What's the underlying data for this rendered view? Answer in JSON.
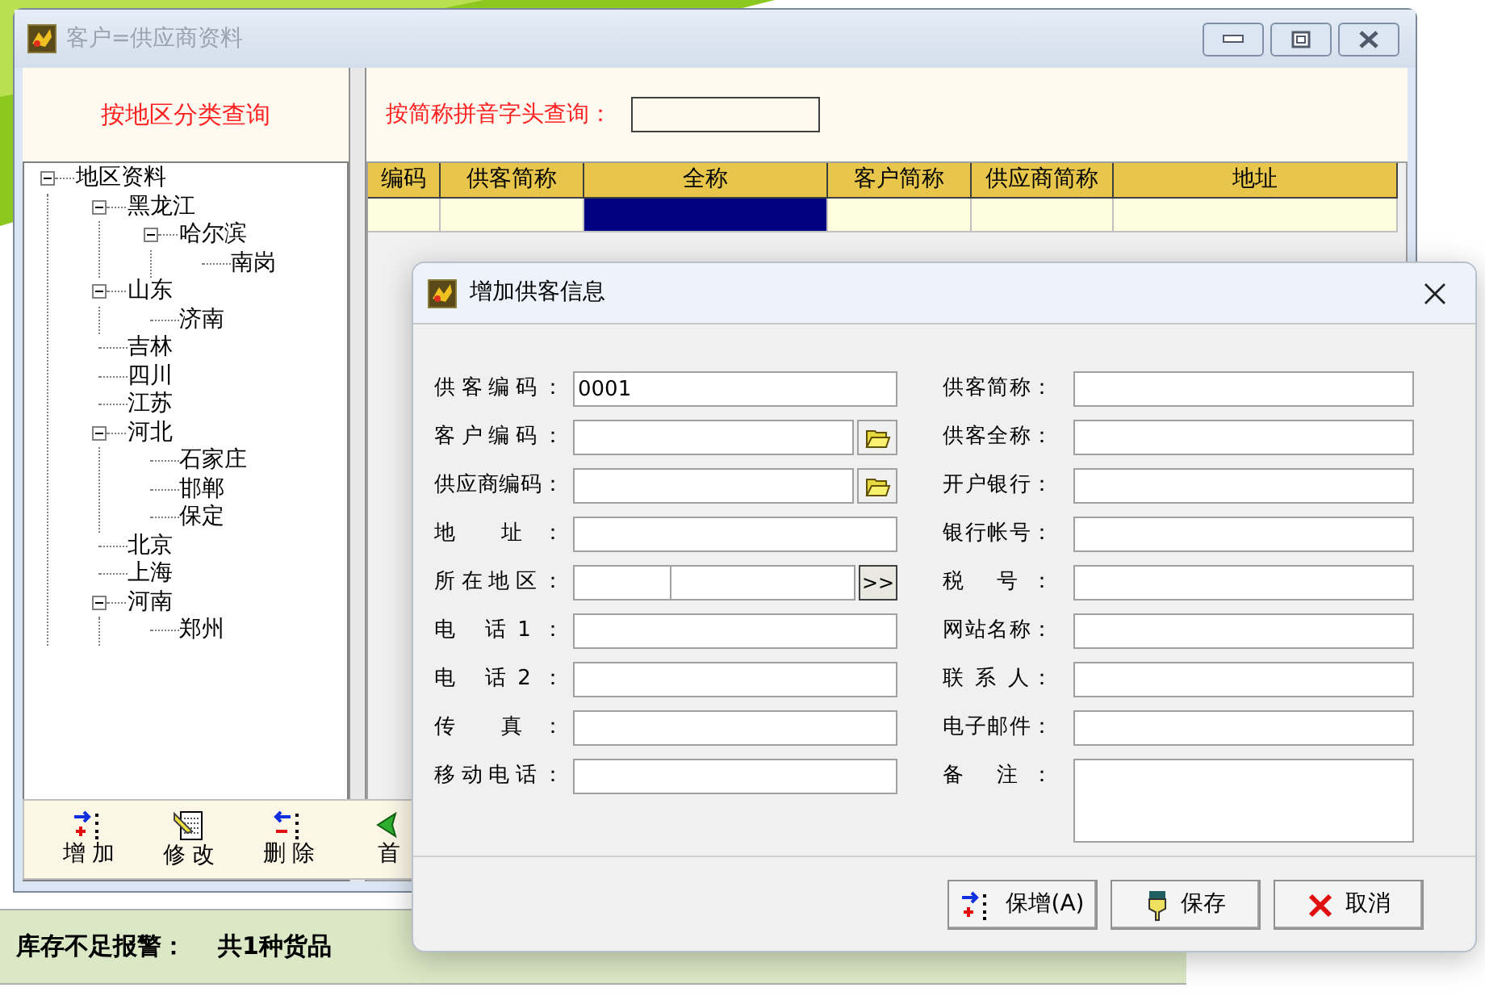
{
  "main_window": {
    "title": "客户=供应商资料"
  },
  "region_panel": {
    "title": "按地区分类查询",
    "tree": [
      {
        "label": "地区资料",
        "expanded": true,
        "children": [
          {
            "label": "黑龙江",
            "expanded": true,
            "children": [
              {
                "label": "哈尔滨",
                "expanded": true,
                "children": [
                  {
                    "label": "南岗"
                  }
                ]
              }
            ]
          },
          {
            "label": "山东",
            "expanded": true,
            "children": [
              {
                "label": "济南"
              }
            ]
          },
          {
            "label": "吉林"
          },
          {
            "label": "四川"
          },
          {
            "label": "江苏"
          },
          {
            "label": "河北",
            "expanded": true,
            "children": [
              {
                "label": "石家庄"
              },
              {
                "label": "邯郸"
              },
              {
                "label": "保定"
              }
            ]
          },
          {
            "label": "北京"
          },
          {
            "label": "上海"
          },
          {
            "label": "河南",
            "expanded": true,
            "children": [
              {
                "label": "郑州"
              }
            ]
          }
        ]
      }
    ]
  },
  "search": {
    "label": "按简称拼音字头查询："
  },
  "grid": {
    "columns": [
      "编码",
      "供客简称",
      "全称",
      "客户简称",
      "供应商简称",
      "地址"
    ],
    "rows": [
      {
        "cells": [
          {
            "selected": false
          },
          {
            "selected": false
          },
          {
            "selected": true
          },
          {
            "selected": false
          },
          {
            "selected": false
          },
          {
            "selected": false
          }
        ]
      }
    ]
  },
  "toolbar": [
    {
      "label": "增 加",
      "kind": "add"
    },
    {
      "label": "修 改",
      "kind": "edit"
    },
    {
      "label": "删 除",
      "kind": "delete"
    },
    {
      "label": "首",
      "kind": "first"
    }
  ],
  "status_bar": {
    "label": "库存不足报警：",
    "message": "共1种货品"
  },
  "dialog": {
    "title": "增加供客信息",
    "left_fields": [
      {
        "label": "供客编码：",
        "kind": "text",
        "value": "0001"
      },
      {
        "label": "客户编码：",
        "kind": "lookup"
      },
      {
        "label": "供应商编码：",
        "kind": "lookup"
      },
      {
        "label": "地 址：",
        "kind": "text"
      },
      {
        "label": "所在地区：",
        "kind": "region",
        "button": ">>"
      },
      {
        "label": "电 话1：",
        "kind": "text"
      },
      {
        "label": "电 话2：",
        "kind": "text"
      },
      {
        "label": "传 真：",
        "kind": "text"
      },
      {
        "label": "移动电话：",
        "kind": "text"
      }
    ],
    "right_fields": [
      {
        "label": "供客简称：",
        "kind": "text"
      },
      {
        "label": "供客全称：",
        "kind": "text"
      },
      {
        "label": "开户银行：",
        "kind": "text"
      },
      {
        "label": "银行帐号：",
        "kind": "text"
      },
      {
        "label": "税 号：",
        "kind": "text"
      },
      {
        "label": "网站名称：",
        "kind": "text"
      },
      {
        "label": "联 系 人：",
        "kind": "text"
      },
      {
        "label": "电子邮件：",
        "kind": "text"
      },
      {
        "label": "备 注：",
        "kind": "memo"
      }
    ],
    "buttons": [
      {
        "label": "保增(A)",
        "kind": "save_add"
      },
      {
        "label": "保存",
        "kind": "save"
      },
      {
        "label": "取消",
        "kind": "cancel"
      }
    ]
  }
}
